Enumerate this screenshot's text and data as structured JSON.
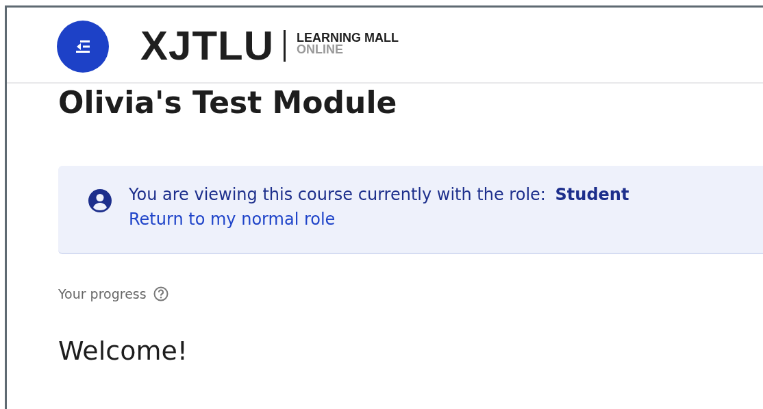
{
  "header": {
    "logo": {
      "name": "XJTLU",
      "line_1": "LEARNING MALL",
      "line_2": "ONLINE"
    }
  },
  "course": {
    "title": "Olivia's Test Module"
  },
  "role_notice": {
    "message": "You are viewing this course currently with the role: **Student**",
    "link": "Return to my normal role"
  },
  "progress": {
    "label": "Your progress"
  },
  "section": {
    "title": "Welcome!"
  }
}
